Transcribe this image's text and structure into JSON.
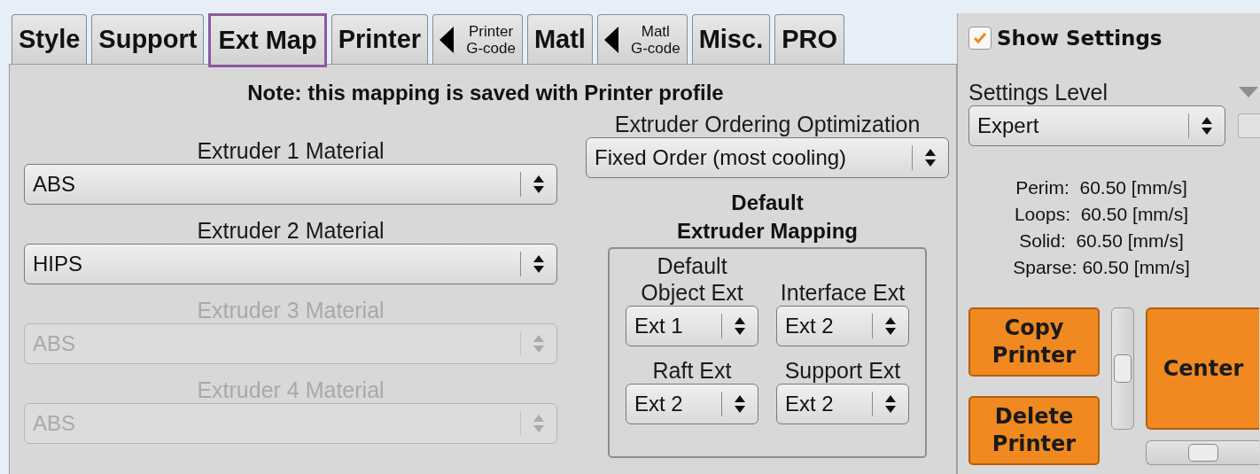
{
  "tabs": [
    {
      "label": "Style",
      "kind": "text",
      "selected": false
    },
    {
      "label": "Support",
      "kind": "text",
      "selected": false
    },
    {
      "label": "Ext Map",
      "kind": "text",
      "selected": true
    },
    {
      "label": "Printer",
      "kind": "text",
      "selected": false
    },
    {
      "label": "Printer",
      "sublabel": "G-code",
      "kind": "gcode",
      "selected": false
    },
    {
      "label": "Matl",
      "kind": "text",
      "selected": false
    },
    {
      "label": "Matl",
      "sublabel": "G-code",
      "kind": "gcode",
      "selected": false
    },
    {
      "label": "Misc.",
      "kind": "text",
      "selected": false
    },
    {
      "label": "PRO",
      "kind": "text",
      "selected": false
    }
  ],
  "note": "Note: this mapping is saved with Printer profile",
  "extruder_materials": [
    {
      "label": "Extruder 1 Material",
      "value": "ABS",
      "disabled": false
    },
    {
      "label": "Extruder 2 Material",
      "value": "HIPS",
      "disabled": false
    },
    {
      "label": "Extruder 3 Material",
      "value": "ABS",
      "disabled": true
    },
    {
      "label": "Extruder 4 Material",
      "value": "ABS",
      "disabled": true
    }
  ],
  "ordering": {
    "label": "Extruder Ordering Optimization",
    "value": "Fixed Order (most cooling)"
  },
  "mapping": {
    "title_lines": [
      "Default",
      "Extruder Mapping"
    ],
    "fields": [
      {
        "label_lines": [
          "Default",
          "Object Ext"
        ],
        "value": "Ext 1"
      },
      {
        "label_lines": [
          "Interface Ext"
        ],
        "value": "Ext 2"
      },
      {
        "label_lines": [
          "Raft Ext"
        ],
        "value": "Ext 2"
      },
      {
        "label_lines": [
          "Support Ext"
        ],
        "value": "Ext 2"
      }
    ]
  },
  "show_settings": {
    "label": "Show Settings",
    "checked": true
  },
  "settings_level": {
    "label": "Settings Level",
    "value": "Expert"
  },
  "speeds": [
    "Perim:  60.50 [mm/s]",
    "Loops:  60.50 [mm/s]",
    "Solid:  60.50 [mm/s]",
    "Sparse: 60.50 [mm/s]"
  ],
  "printer_buttons": [
    {
      "label_lines": [
        "Copy",
        "Printer"
      ]
    },
    {
      "label_lines": [
        "Delete",
        "Printer"
      ]
    }
  ],
  "center_button": {
    "label": "Center"
  },
  "vertical_slider": {
    "level": 0.5
  },
  "horizontal_slider": {
    "level": 0.5
  }
}
